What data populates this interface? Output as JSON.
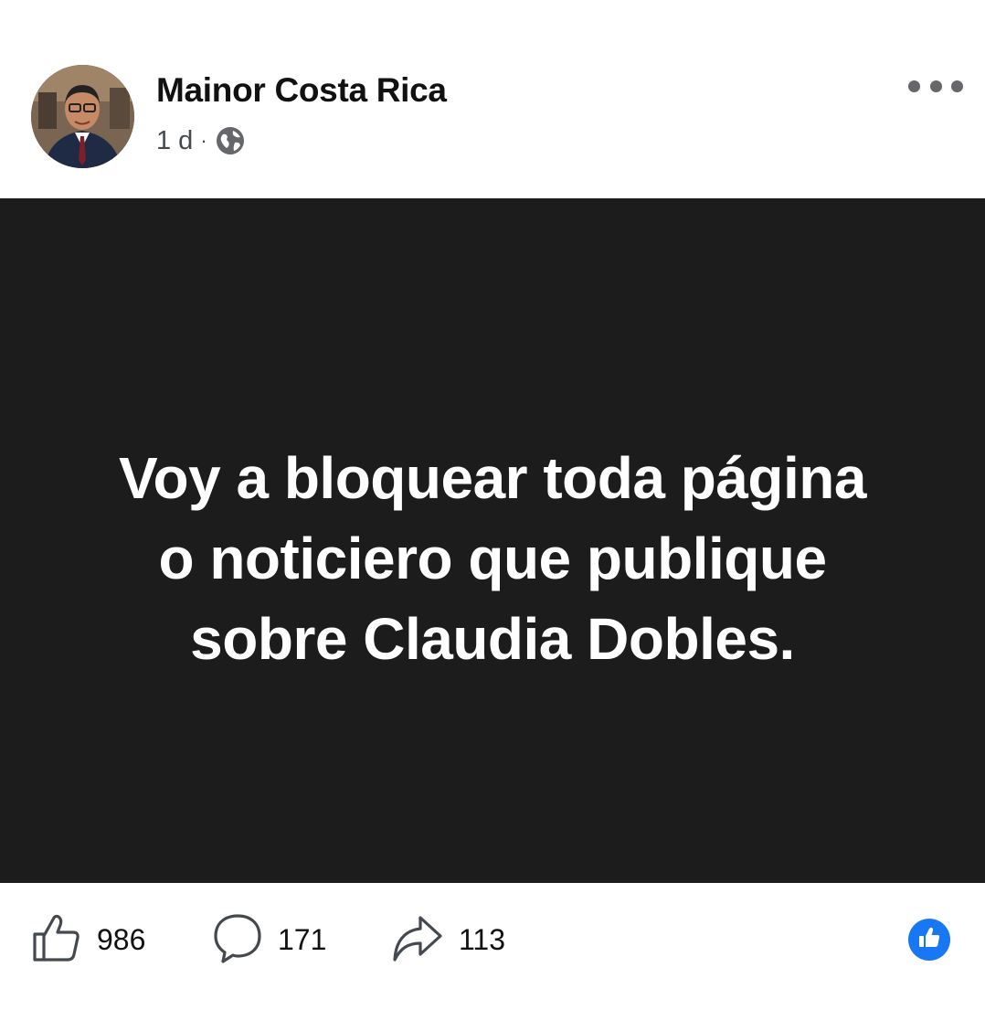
{
  "post": {
    "author": "Mainor Costa Rica",
    "time": "1 d",
    "separator": "·",
    "audience_icon": "globe-icon",
    "text": "Voy a bloquear toda página o noticiero que publique sobre Claudia Dobles.",
    "card_background": "#1c1c1c",
    "text_color": "#ffffff"
  },
  "actions": {
    "like_count": "986",
    "comment_count": "171",
    "share_count": "113"
  },
  "reaction": {
    "icon": "thumbs-up-icon",
    "color": "#1877f2"
  },
  "colors": {
    "secondary_text": "#444950",
    "icon_gray": "#65676b"
  }
}
